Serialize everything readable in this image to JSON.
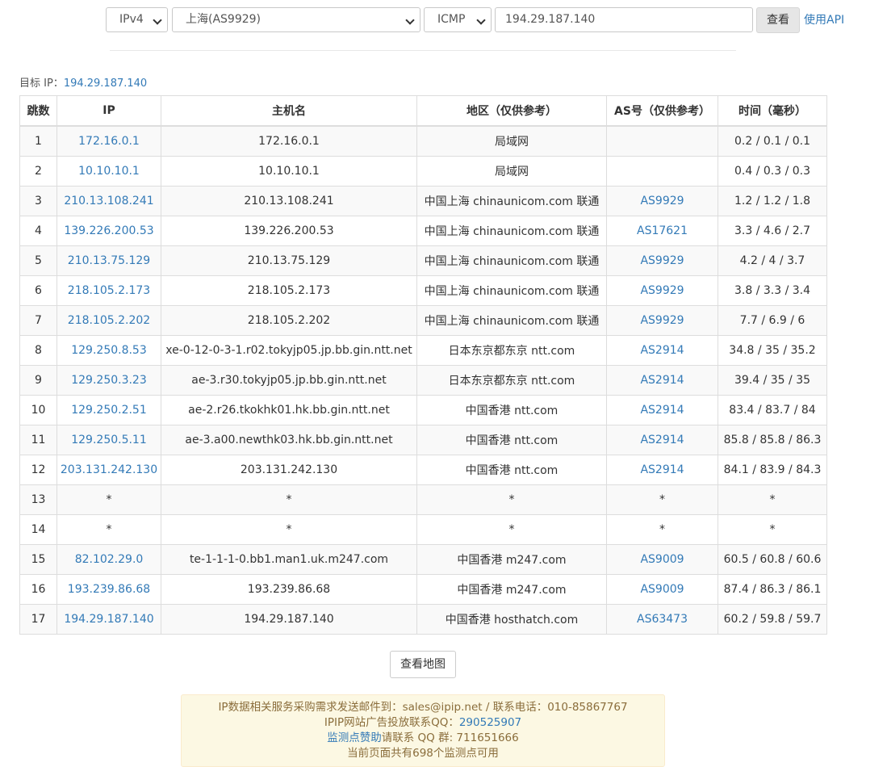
{
  "query": {
    "protocol_version": "IPv4",
    "node": "上海(AS9929)",
    "method": "ICMP",
    "target_value": "194.29.187.140",
    "submit_label": "查看",
    "api_label": "使用API"
  },
  "target": {
    "label": "目标 IP：",
    "ip": "194.29.187.140"
  },
  "table": {
    "headers": [
      "跳数",
      "IP",
      "主机名",
      "地区（仅供参考）",
      "AS号（仅供参考）",
      "时间（毫秒）"
    ],
    "rows": [
      {
        "hop": "1",
        "ip": "172.16.0.1",
        "host": "172.16.0.1",
        "region": "局域网",
        "asn": "",
        "time": "0.2 / 0.1 / 0.1"
      },
      {
        "hop": "2",
        "ip": "10.10.10.1",
        "host": "10.10.10.1",
        "region": "局域网",
        "asn": "",
        "time": "0.4 / 0.3 / 0.3"
      },
      {
        "hop": "3",
        "ip": "210.13.108.241",
        "host": "210.13.108.241",
        "region": "中国上海 chinaunicom.com 联通",
        "asn": "AS9929",
        "time": "1.2 / 1.2 / 1.8"
      },
      {
        "hop": "4",
        "ip": "139.226.200.53",
        "host": "139.226.200.53",
        "region": "中国上海 chinaunicom.com 联通",
        "asn": "AS17621",
        "time": "3.3 / 4.6 / 2.7"
      },
      {
        "hop": "5",
        "ip": "210.13.75.129",
        "host": "210.13.75.129",
        "region": "中国上海 chinaunicom.com 联通",
        "asn": "AS9929",
        "time": "4.2 / 4 / 3.7"
      },
      {
        "hop": "6",
        "ip": "218.105.2.173",
        "host": "218.105.2.173",
        "region": "中国上海 chinaunicom.com 联通",
        "asn": "AS9929",
        "time": "3.8 / 3.3 / 3.4"
      },
      {
        "hop": "7",
        "ip": "218.105.2.202",
        "host": "218.105.2.202",
        "region": "中国上海 chinaunicom.com 联通",
        "asn": "AS9929",
        "time": "7.7 / 6.9 / 6"
      },
      {
        "hop": "8",
        "ip": "129.250.8.53",
        "host": "xe-0-12-0-3-1.r02.tokyjp05.jp.bb.gin.ntt.net",
        "region": "日本东京都东京 ntt.com",
        "asn": "AS2914",
        "time": "34.8 / 35 / 35.2"
      },
      {
        "hop": "9",
        "ip": "129.250.3.23",
        "host": "ae-3.r30.tokyjp05.jp.bb.gin.ntt.net",
        "region": "日本东京都东京 ntt.com",
        "asn": "AS2914",
        "time": "39.4 / 35 / 35"
      },
      {
        "hop": "10",
        "ip": "129.250.2.51",
        "host": "ae-2.r26.tkokhk01.hk.bb.gin.ntt.net",
        "region": "中国香港 ntt.com",
        "asn": "AS2914",
        "time": "83.4 / 83.7 / 84"
      },
      {
        "hop": "11",
        "ip": "129.250.5.11",
        "host": "ae-3.a00.newthk03.hk.bb.gin.ntt.net",
        "region": "中国香港 ntt.com",
        "asn": "AS2914",
        "time": "85.8 / 85.8 / 86.3"
      },
      {
        "hop": "12",
        "ip": "203.131.242.130",
        "host": "203.131.242.130",
        "region": "中国香港 ntt.com",
        "asn": "AS2914",
        "time": "84.1 / 83.9 / 84.3"
      },
      {
        "hop": "13",
        "ip": "*",
        "host": "*",
        "region": "*",
        "asn": "*",
        "time": "*"
      },
      {
        "hop": "14",
        "ip": "*",
        "host": "*",
        "region": "*",
        "asn": "*",
        "time": "*"
      },
      {
        "hop": "15",
        "ip": "82.102.29.0",
        "host": "te-1-1-1-0.bb1.man1.uk.m247.com",
        "region": "中国香港 m247.com",
        "asn": "AS9009",
        "time": "60.5 / 60.8 / 60.6"
      },
      {
        "hop": "16",
        "ip": "193.239.86.68",
        "host": "193.239.86.68",
        "region": "中国香港 m247.com",
        "asn": "AS9009",
        "time": "87.4 / 86.3 / 86.1"
      },
      {
        "hop": "17",
        "ip": "194.29.187.140",
        "host": "194.29.187.140",
        "region": "中国香港 hosthatch.com",
        "asn": "AS63473",
        "time": "60.2 / 59.8 / 59.7"
      }
    ]
  },
  "map_button": "查看地图",
  "notice": {
    "line1": "IP数据相关服务采购需求发送邮件到：sales@ipip.net / 联系电话：010-85867767",
    "line2_prefix": "IPIP网站广告投放联系QQ：",
    "line2_qq": "290525907",
    "line3_link": "监测点赞助",
    "line3_rest": "请联系 QQ 群: 711651666",
    "line4": "当前页面共有698个监测点可用"
  }
}
